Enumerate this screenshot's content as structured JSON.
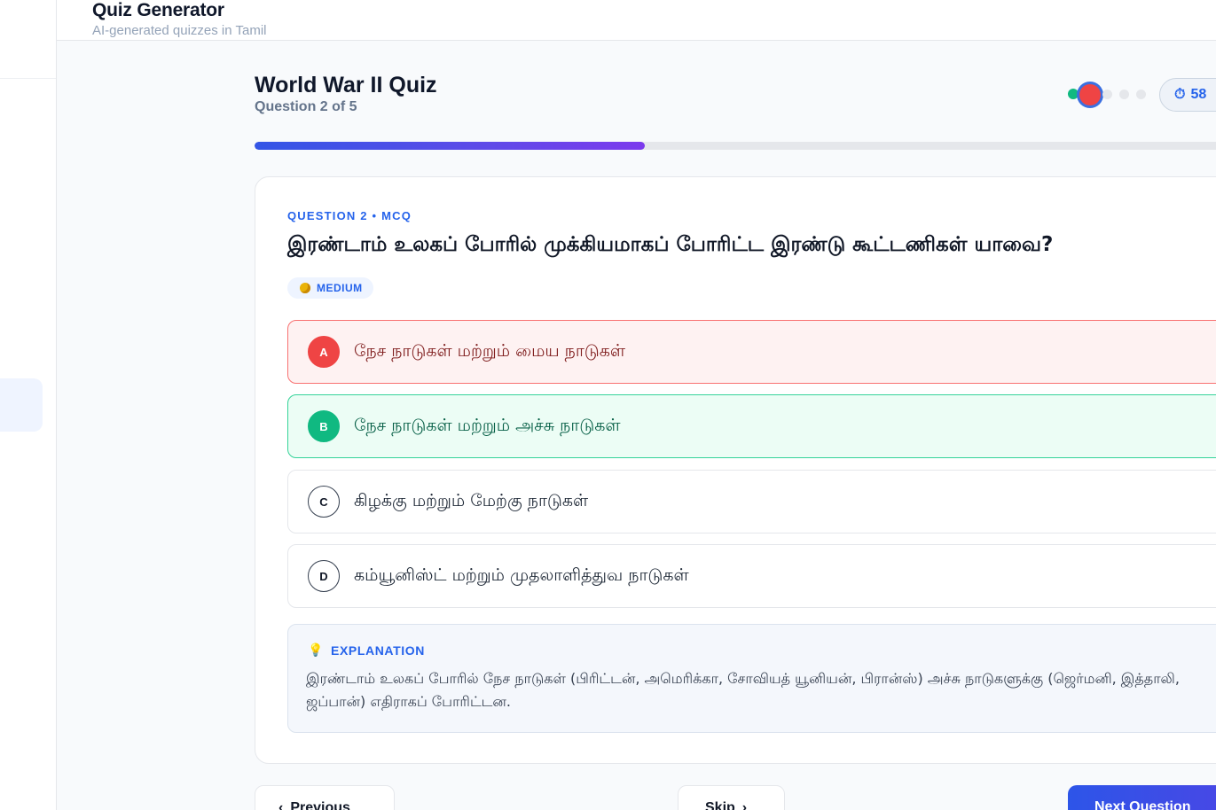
{
  "header": {
    "title": "Quiz Generator",
    "subtitle": "AI-generated quizzes in Tamil"
  },
  "quiz": {
    "title": "World War II Quiz",
    "counter": "Question 2 of 5",
    "timer": "58",
    "progress_fraction": 0.4
  },
  "question": {
    "meta": "QUESTION 2 • MCQ",
    "text": "இரண்டாம் உலகப் போரில் முக்கியமாகப் போரிட்ட இரண்டு கூட்டணிகள் யாவை?",
    "difficulty": "MEDIUM",
    "options": [
      {
        "letter": "A",
        "text": "நேச நாடுகள் மற்றும் மைய நாடுகள்",
        "state": "wrong"
      },
      {
        "letter": "B",
        "text": "நேச நாடுகள் மற்றும் அச்சு நாடுகள்",
        "state": "correct"
      },
      {
        "letter": "C",
        "text": "கிழக்கு மற்றும் மேற்கு நாடுகள்",
        "state": "neutral"
      },
      {
        "letter": "D",
        "text": "கம்யூனிஸ்ட் மற்றும் முதலாளித்துவ நாடுகள்",
        "state": "neutral"
      }
    ]
  },
  "explanation": {
    "label": "EXPLANATION",
    "text": "இரண்டாம் உலகப் போரில் நேச நாடுகள் (பிரிட்டன், அமெரிக்கா, சோவியத் யூனியன், பிரான்ஸ்) அச்சு நாடுகளுக்கு (ஜெர்மனி, இத்தாலி, ஜப்பான்) எதிராகப் போரிட்டன."
  },
  "nav": {
    "previous": "Previous",
    "skip": "Skip",
    "next": "Next Question"
  },
  "colors": {
    "accent": "#2563eb",
    "correct": "#10b981",
    "wrong": "#ef4444",
    "dot_done": "#10b981",
    "dot_current": "#ef4444",
    "dot_pending": "#e5e7eb"
  },
  "icons": {
    "timer": "stopwatch-icon",
    "difficulty": "medium-dot-icon",
    "explanation": "lightbulb-icon",
    "previous": "chevron-left-icon",
    "skip": "chevron-right-icon"
  }
}
